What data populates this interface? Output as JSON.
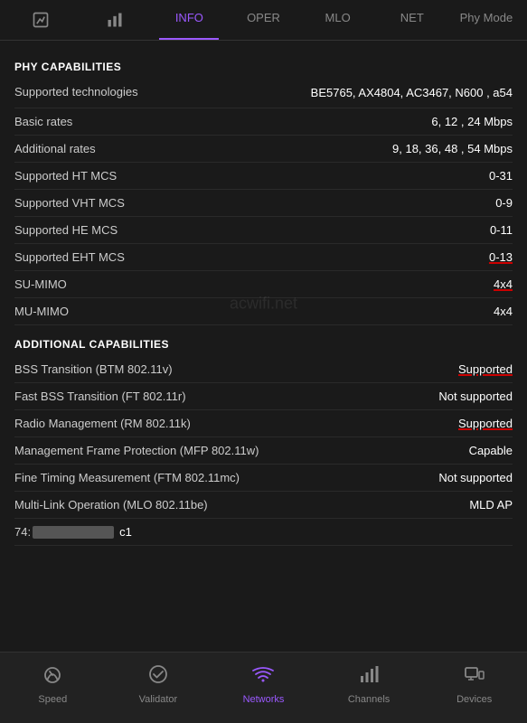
{
  "topNav": {
    "items": [
      {
        "id": "graph",
        "label": "Graph",
        "icon": "graph",
        "active": false
      },
      {
        "id": "bars",
        "label": "Bars",
        "icon": "bars",
        "active": false
      },
      {
        "id": "info",
        "label": "INFO",
        "icon": "info",
        "active": true
      },
      {
        "id": "oper",
        "label": "OPER",
        "icon": "oper",
        "active": false
      },
      {
        "id": "mlo",
        "label": "MLO",
        "icon": "mlo",
        "active": false
      },
      {
        "id": "net",
        "label": "NET",
        "icon": "net",
        "active": false
      },
      {
        "id": "phymode",
        "label": "Phy Mode",
        "icon": "phymode",
        "active": false
      }
    ]
  },
  "phyCapabilities": {
    "header": "PHY CAPABILITIES",
    "rows": [
      {
        "label": "Supported technologies",
        "value": "BE5765, AX4804, AC3467, N600 , a54",
        "underline": false,
        "multiline": true
      },
      {
        "label": "Basic rates",
        "value": "6, 12 , 24 Mbps",
        "underline": false
      },
      {
        "label": "Additional rates",
        "value": "9, 18, 36, 48 , 54 Mbps",
        "underline": false
      },
      {
        "label": "Supported HT MCS",
        "value": "0-31",
        "underline": false
      },
      {
        "label": "Supported VHT MCS",
        "value": "0-9",
        "underline": false
      },
      {
        "label": "Supported HE MCS",
        "value": "0-11",
        "underline": false
      },
      {
        "label": "Supported EHT MCS",
        "value": "0-13",
        "underline": true
      },
      {
        "label": "SU-MIMO",
        "value": "4x4",
        "underline": true
      },
      {
        "label": "MU-MIMO",
        "value": "4x4",
        "underline": false
      }
    ]
  },
  "additionalCapabilities": {
    "header": "ADDITIONAL CAPABILITIES",
    "rows": [
      {
        "label": "BSS Transition (BTM 802.11v)",
        "value": "Supported",
        "underline": true
      },
      {
        "label": "Fast BSS Transition (FT 802.11r)",
        "value": "Not supported",
        "underline": false
      },
      {
        "label": "Radio Management (RM 802.11k)",
        "value": "Supported",
        "underline": true
      },
      {
        "label": "Management Frame Protection (MFP 802.11w)",
        "value": "Capable",
        "underline": false
      },
      {
        "label": "Fine Timing Measurement (FTM 802.11mc)",
        "value": "Not supported",
        "underline": false
      },
      {
        "label": "Multi-Link Operation (MLO 802.11be)",
        "value": "MLD AP",
        "underline": false
      }
    ]
  },
  "macRow": {
    "prefix": "74:",
    "suffix": "c1"
  },
  "watermark": "acwifi.net",
  "bottomNav": {
    "items": [
      {
        "id": "speed",
        "label": "Speed",
        "active": false
      },
      {
        "id": "validator",
        "label": "Validator",
        "active": false
      },
      {
        "id": "networks",
        "label": "Networks",
        "active": true
      },
      {
        "id": "channels",
        "label": "Channels",
        "active": false
      },
      {
        "id": "devices",
        "label": "Devices",
        "active": false
      }
    ]
  }
}
